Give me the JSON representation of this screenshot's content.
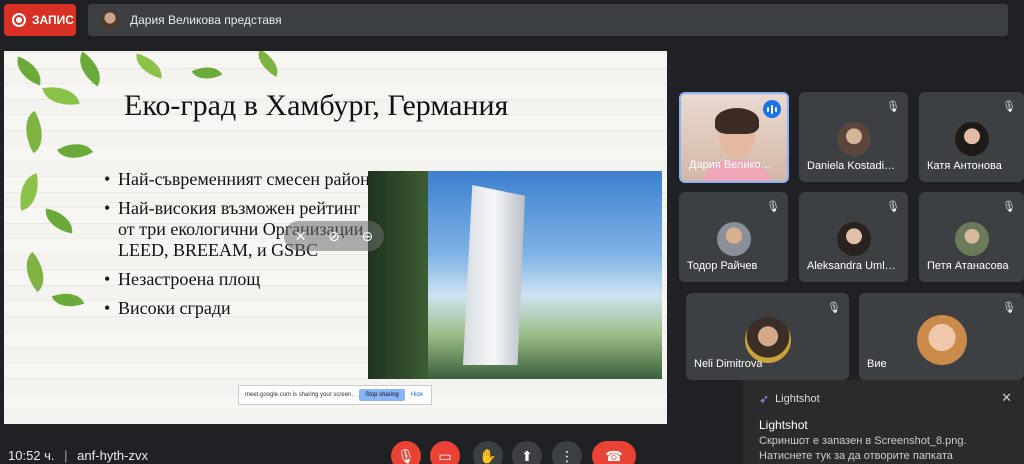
{
  "top": {
    "record_label": "ЗАПИС",
    "presenting_text": "Дария Великова представя"
  },
  "slide": {
    "title": "Еко-град в Хамбург, Германия",
    "bullets": [
      "Най-съвременният смесен район",
      "Най-високия възможен рейтинг от три екологични Организации - LEED, BREEAM, и GSBC",
      "Незастроена площ",
      "Високи сгради"
    ],
    "share_bar": {
      "text": "meet.google.com is sharing your screen.",
      "stop": "Stop sharing",
      "hide": "Hide"
    }
  },
  "participants": [
    {
      "name": "Дария Велико…",
      "speaking": true
    },
    {
      "name": "Daniela Kostadi…"
    },
    {
      "name": "Катя Антонова"
    },
    {
      "name": "Тодор Райчев"
    },
    {
      "name": "Aleksandra Uml…"
    },
    {
      "name": "Петя Атанасова"
    },
    {
      "name": "Neli Dimitrova"
    },
    {
      "name": "Вие"
    }
  ],
  "bottom": {
    "time": "10:52 ч.",
    "meeting_code": "anf-hyth-zvx"
  },
  "toast": {
    "app": "Lightshot",
    "title": "Lightshot",
    "line1": "Скриншот е запазен в Screenshot_8.png.",
    "line2": "Натиснете тук за да отворите папката"
  },
  "colors": {
    "end_call": "#ea4335",
    "record": "#d93025",
    "active_border": "#8ab4f8"
  }
}
